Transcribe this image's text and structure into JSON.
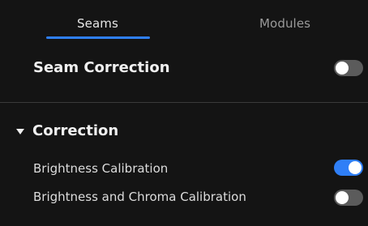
{
  "tabs": {
    "seams_label": "Seams",
    "modules_label": "Modules",
    "active": "Seams"
  },
  "seam_correction": {
    "label": "Seam Correction",
    "enabled": false
  },
  "correction_section": {
    "title": "Correction",
    "expanded": true,
    "items": [
      {
        "label": "Brightness Calibration",
        "enabled": true
      },
      {
        "label": "Brightness and Chroma Calibration",
        "enabled": false
      }
    ]
  },
  "colors": {
    "accent": "#2f7ff7",
    "toggle_on": "#2f7ff7",
    "toggle_off": "#5b5b5b",
    "background": "#141414"
  }
}
